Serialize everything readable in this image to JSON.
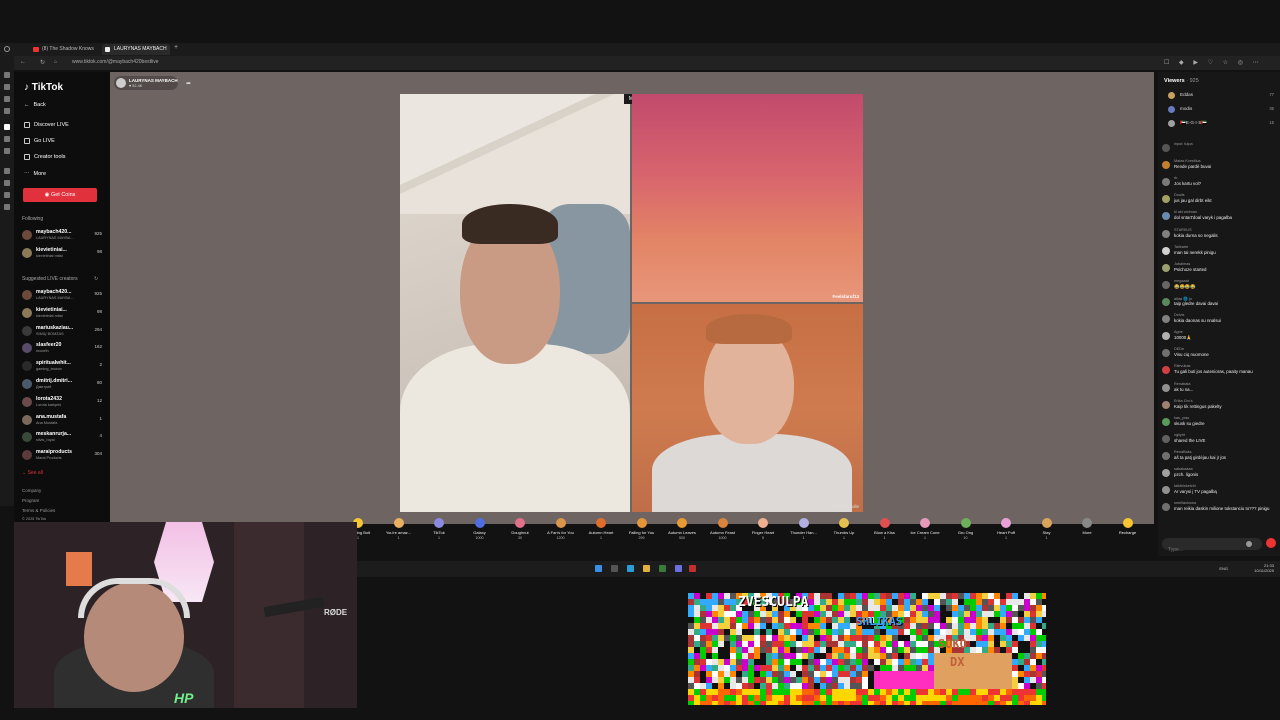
{
  "browser": {
    "tabs": [
      {
        "label": "(8) The Shadow Knows",
        "active": false
      },
      {
        "label": "LAURYNAS MAYBACH",
        "active": true
      }
    ],
    "url": "www.tiktok.com/@maybach420bestlive"
  },
  "tiktok_sidebar": {
    "logo": "TikTok",
    "nav": [
      "Back",
      "Discover LIVE",
      "Go LIVE",
      "Creator tools",
      "More"
    ],
    "get_coins": "Get Coins",
    "following_header": "Following",
    "following": [
      {
        "name": "maybach420...",
        "sub": "LAURYNAS MAYBA...",
        "count": "925"
      },
      {
        "name": "kievietiniai...",
        "sub": "kievietiniai mitai",
        "count": "98"
      }
    ],
    "suggested_header": "Suggested LIVE creators",
    "suggested": [
      {
        "name": "maybach420...",
        "sub": "LAURYNAS MAYBA...",
        "count": "925"
      },
      {
        "name": "kievietiniai...",
        "sub": "kievietiniai mitai",
        "count": "98"
      },
      {
        "name": "mariuskaziau...",
        "sub": "SIMIŲ BOMŽAS",
        "count": "294"
      },
      {
        "name": "slasfeer20",
        "sub": "mooeth",
        "count": "162"
      },
      {
        "name": "spiritualwhit...",
        "sub": "gaming_brusov",
        "count": "2"
      },
      {
        "name": "dmitrij.dmitri...",
        "sub": "Дмитрий",
        "count": "80"
      },
      {
        "name": "lorota2432",
        "sub": "Lorota karkpriš",
        "count": "12"
      },
      {
        "name": "ana.mustafa",
        "sub": "Ana Mustafa",
        "count": "1"
      },
      {
        "name": "meskanrurja...",
        "sub": "silvis_royal",
        "count": "4"
      },
      {
        "name": "maraiproducts",
        "sub": "Marai Products",
        "count": "304"
      }
    ],
    "see_all": "See all",
    "footer": [
      "Company",
      "Program",
      "Terms & Policies",
      "© 2025 TikTok"
    ]
  },
  "stream": {
    "host_name": "LAURYNAS MAYBACH",
    "host_likes": "♥ 52.4K",
    "versus_badge": "M",
    "guest_label": "Feelsfaruf13",
    "guest2_label": "SandraPadolle"
  },
  "gifts": [
    {
      "name": "Lightning Bolt",
      "price": "1",
      "color": "#f6c531"
    },
    {
      "name": "You're amaz...",
      "price": "1",
      "color": "#e8b060"
    },
    {
      "name": "TikTok",
      "price": "1",
      "color": "#8a8ae0"
    },
    {
      "name": "Galaxy",
      "price": "1000",
      "color": "#4f6fe0"
    },
    {
      "name": "Doughnut",
      "price": "30",
      "color": "#e2708a"
    },
    {
      "name": "A Fan's for You",
      "price": "1200",
      "color": "#d9954a"
    },
    {
      "name": "Autumn Heart",
      "price": "1",
      "color": "#e06d2c"
    },
    {
      "name": "Falling for You",
      "price": "299",
      "color": "#e3953a"
    },
    {
      "name": "Autumn Leaves",
      "price": "500",
      "color": "#e89b32"
    },
    {
      "name": "Autumn Feast",
      "price": "1000",
      "color": "#d8843c"
    },
    {
      "name": "Finger Heart",
      "price": "5",
      "color": "#f0b090"
    },
    {
      "name": "Thunder Han...",
      "price": "1",
      "color": "#b0b0e0"
    },
    {
      "name": "Thumbs Up",
      "price": "1",
      "color": "#e8c050"
    },
    {
      "name": "Blow a Kiss",
      "price": "1",
      "color": "#e05050"
    },
    {
      "name": "Ice Cream Cone",
      "price": "1",
      "color": "#e49ab8"
    },
    {
      "name": "Gru Ong",
      "price": "10",
      "color": "#6db05a"
    },
    {
      "name": "Heart Puff",
      "price": "1",
      "color": "#e8a0d8"
    },
    {
      "name": "Stay",
      "price": "1",
      "color": "#d9a55a"
    },
    {
      "name": "More",
      "price": "",
      "color": "#888888"
    },
    {
      "name": "Recharge",
      "price": "",
      "color": "#f6c531"
    }
  ],
  "chat": {
    "viewers_label": "Viewers",
    "viewers_count": "· 925",
    "top_viewers": [
      {
        "name": "Eddas",
        "count": "77"
      },
      {
        "name": "modis",
        "count": "35"
      },
      {
        "name": "🇦🇪E·G·I·S🇦🇪",
        "count": "15"
      }
    ],
    "messages": [
      {
        "user": "input: tuipa",
        "text": "",
        "color": "#555555"
      },
      {
        "user": "Matas Kvestlius",
        "text": "Rende pardè buvai",
        "color": "#c08030"
      },
      {
        "user": "rb",
        "text": "Jos kartu vol?",
        "color": "#7a7a7a"
      },
      {
        "user": "Doulis",
        "text": "jus jau gal dirbt eikt",
        "color": "#a0a060"
      },
      {
        "user": "ši akt widman",
        "text": "dol sntart'doal varyk i pagalba",
        "color": "#6a8ab0"
      },
      {
        "user": "STARKUS",
        "text": "kokia durna so negalis",
        "color": "#808080"
      },
      {
        "user": "Tailearte",
        "text": "man tai nerekk pinigu",
        "color": "#d0d0d0"
      },
      {
        "user": "Jubalmas",
        "text": "Psichoze started",
        "color": "#9aa070"
      },
      {
        "user": "megaaat",
        "text": "😂😂😂😂",
        "color": "#666666"
      },
      {
        "user": "alkta 🌐 jo",
        "text": "taip gledre davai davai",
        "color": "#5a8a5a"
      },
      {
        "user": "Delvis",
        "text": "kokia daonas su nnalsui",
        "color": "#808080"
      },
      {
        "user": "Agne",
        "text": "10000🙏",
        "color": "#b0b0b0"
      },
      {
        "user": "DEDe",
        "text": "Visu ciq nuomone",
        "color": "#707070"
      },
      {
        "user": "Rilevukas",
        "text": "Tu gali buti jos autenioras, paaity manau",
        "color": "#d04040"
      },
      {
        "user": "Renabata",
        "text": "ak tu na...",
        "color": "#909090"
      },
      {
        "user": "Erika Gru's",
        "text": "Kaip tik rettingus pakelty",
        "color": "#a08070"
      },
      {
        "user": "kas_yras",
        "text": "skusk su giedre",
        "color": "#5a9a5a"
      },
      {
        "user": "ngllyrit",
        "text": "shared the LIVE",
        "color": "#606060"
      },
      {
        "user": "RenaBaks",
        "text": "aš ta patį girdėjau kai jr jūs",
        "color": "#707070"
      },
      {
        "user": "sabakaaaa",
        "text": "pzch. ligonis",
        "color": "#a0a0a0"
      },
      {
        "user": "talkthisketchi",
        "text": "Ar varysi į TV pagalbą",
        "color": "#909090"
      },
      {
        "user": "smellashowa",
        "text": "man reikia daskin milione tukstanciu to??? pinigu",
        "color": "#707070"
      }
    ],
    "input_placeholder": "Type..."
  },
  "taskbar": {
    "lang": "ENG",
    "time": "21:33",
    "date": "10/11/2025"
  },
  "webcam": {
    "mic_brand": "RØDE",
    "overlay_tag": "HP"
  },
  "pixel_art": {
    "text_lines": [
      "ZVESCULPA",
      "SHLIKAS",
      "SOKO",
      "DX"
    ]
  }
}
